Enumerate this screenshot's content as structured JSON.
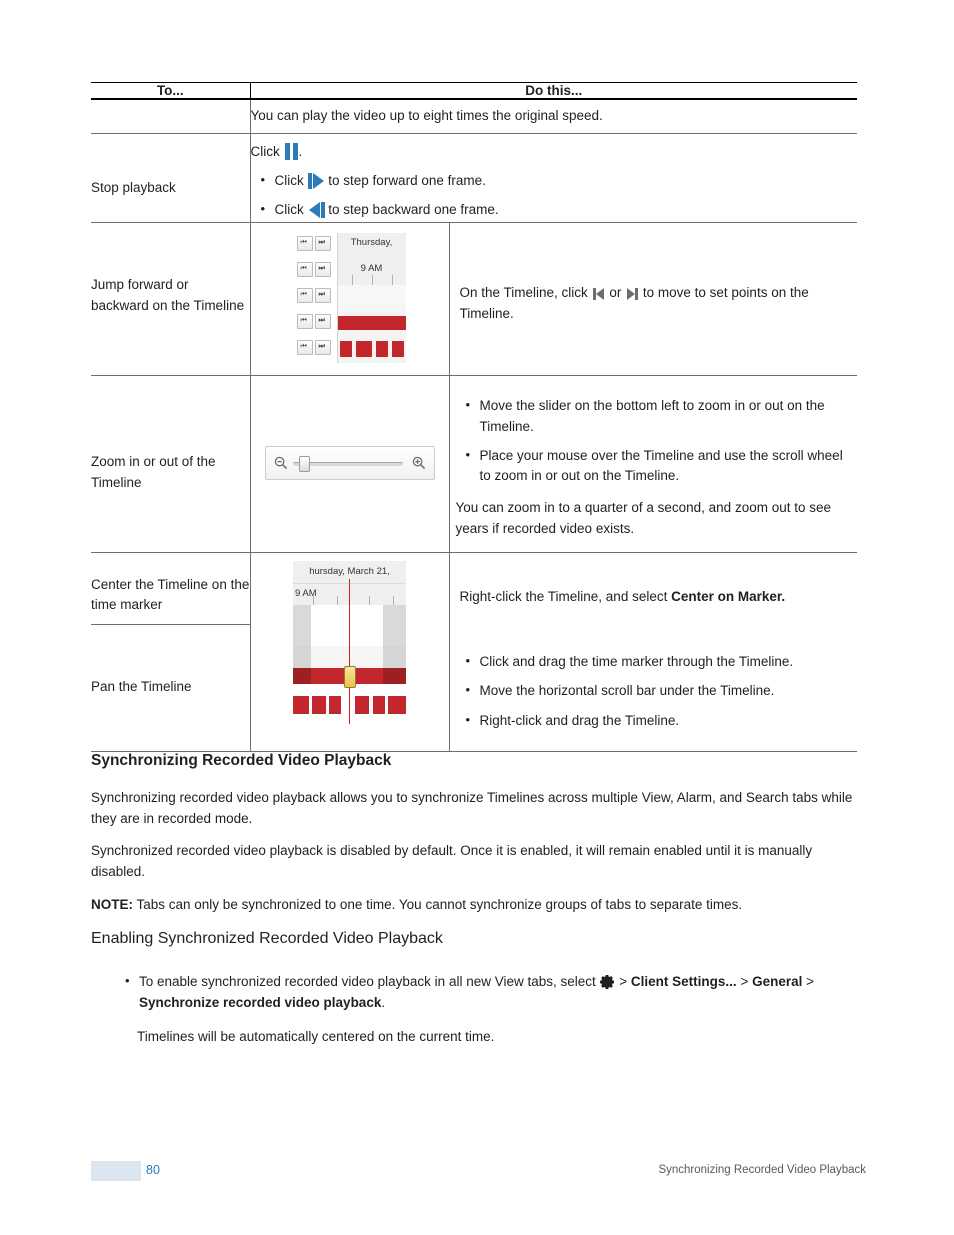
{
  "table": {
    "headers": {
      "col1": "To...",
      "col2": "Do this..."
    },
    "rows": [
      {
        "to": "",
        "do_text": "You can play the video up to eight times the original speed."
      },
      {
        "to": "Stop playback",
        "click_label": "Click",
        "click_period": ".",
        "bullets": [
          {
            "pre": "Click",
            "post": "to step forward one frame."
          },
          {
            "pre": "Click",
            "post": "to step backward one frame."
          }
        ]
      },
      {
        "to": "Jump forward or backward on the Timeline",
        "do_text_a": "On the Timeline, click",
        "do_text_b": "or",
        "do_text_c": "to move to set points on the Timeline.",
        "shot": {
          "day_label": "Thursday,",
          "time_label": "9 AM"
        }
      },
      {
        "to": "Zoom in or out of the Timeline",
        "bullets": [
          "Move the slider on the bottom left to zoom in or out on the Timeline.",
          "Place your mouse over the Timeline and use the scroll wheel to zoom in or out on the Timeline."
        ],
        "trailing": "You can zoom in to a quarter of a second, and zoom out to see years if recorded video exists."
      },
      {
        "to": "Center the Timeline on the time marker",
        "do_text_a": "Right-click the Timeline, and select ",
        "do_text_bold": "Center on Marker.",
        "shot": {
          "day_label": "hursday, March 21,",
          "time_label": "9 AM"
        }
      },
      {
        "to": "Pan the Timeline",
        "bullets": [
          "Click and drag the time marker through the Timeline.",
          "Move the horizontal scroll bar under the Timeline.",
          "Right-click and drag the Timeline."
        ]
      }
    ]
  },
  "sections": {
    "heading": "Synchronizing Recorded Video Playback",
    "para1": "Synchronizing recorded video playback allows you to synchronize Timelines across multiple View, Alarm, and Search tabs while they are in recorded mode.",
    "para2": "Synchronized recorded video playback is disabled by default. Once it is enabled, it will remain enabled until it is manually disabled.",
    "note_label": "NOTE:",
    "note_text": " Tabs can only be synchronized to one time. You cannot synchronize groups of tabs to separate times.",
    "subheading": "Enabling Synchronized Recorded Video Playback",
    "bullet_pre": "To enable synchronized recorded video playback in all new View tabs, select ",
    "bullet_gt1": " > ",
    "bullet_bold1": "Client Settings...",
    "bullet_gt2": " > ",
    "bullet_bold2": "General",
    "bullet_gt3": " > ",
    "bullet_bold3": "Synchronize recorded video playback",
    "bullet_end": ".",
    "closing": "Timelines will be automatically centered on the current time."
  },
  "footer": {
    "page_number": "80",
    "title": "Synchronizing Recorded Video Playback"
  },
  "colors": {
    "accent_blue": "#2b7bb9",
    "bar_red": "#c1272d",
    "marker_red": "#d42027",
    "footer_link": "#2b7bb9"
  }
}
